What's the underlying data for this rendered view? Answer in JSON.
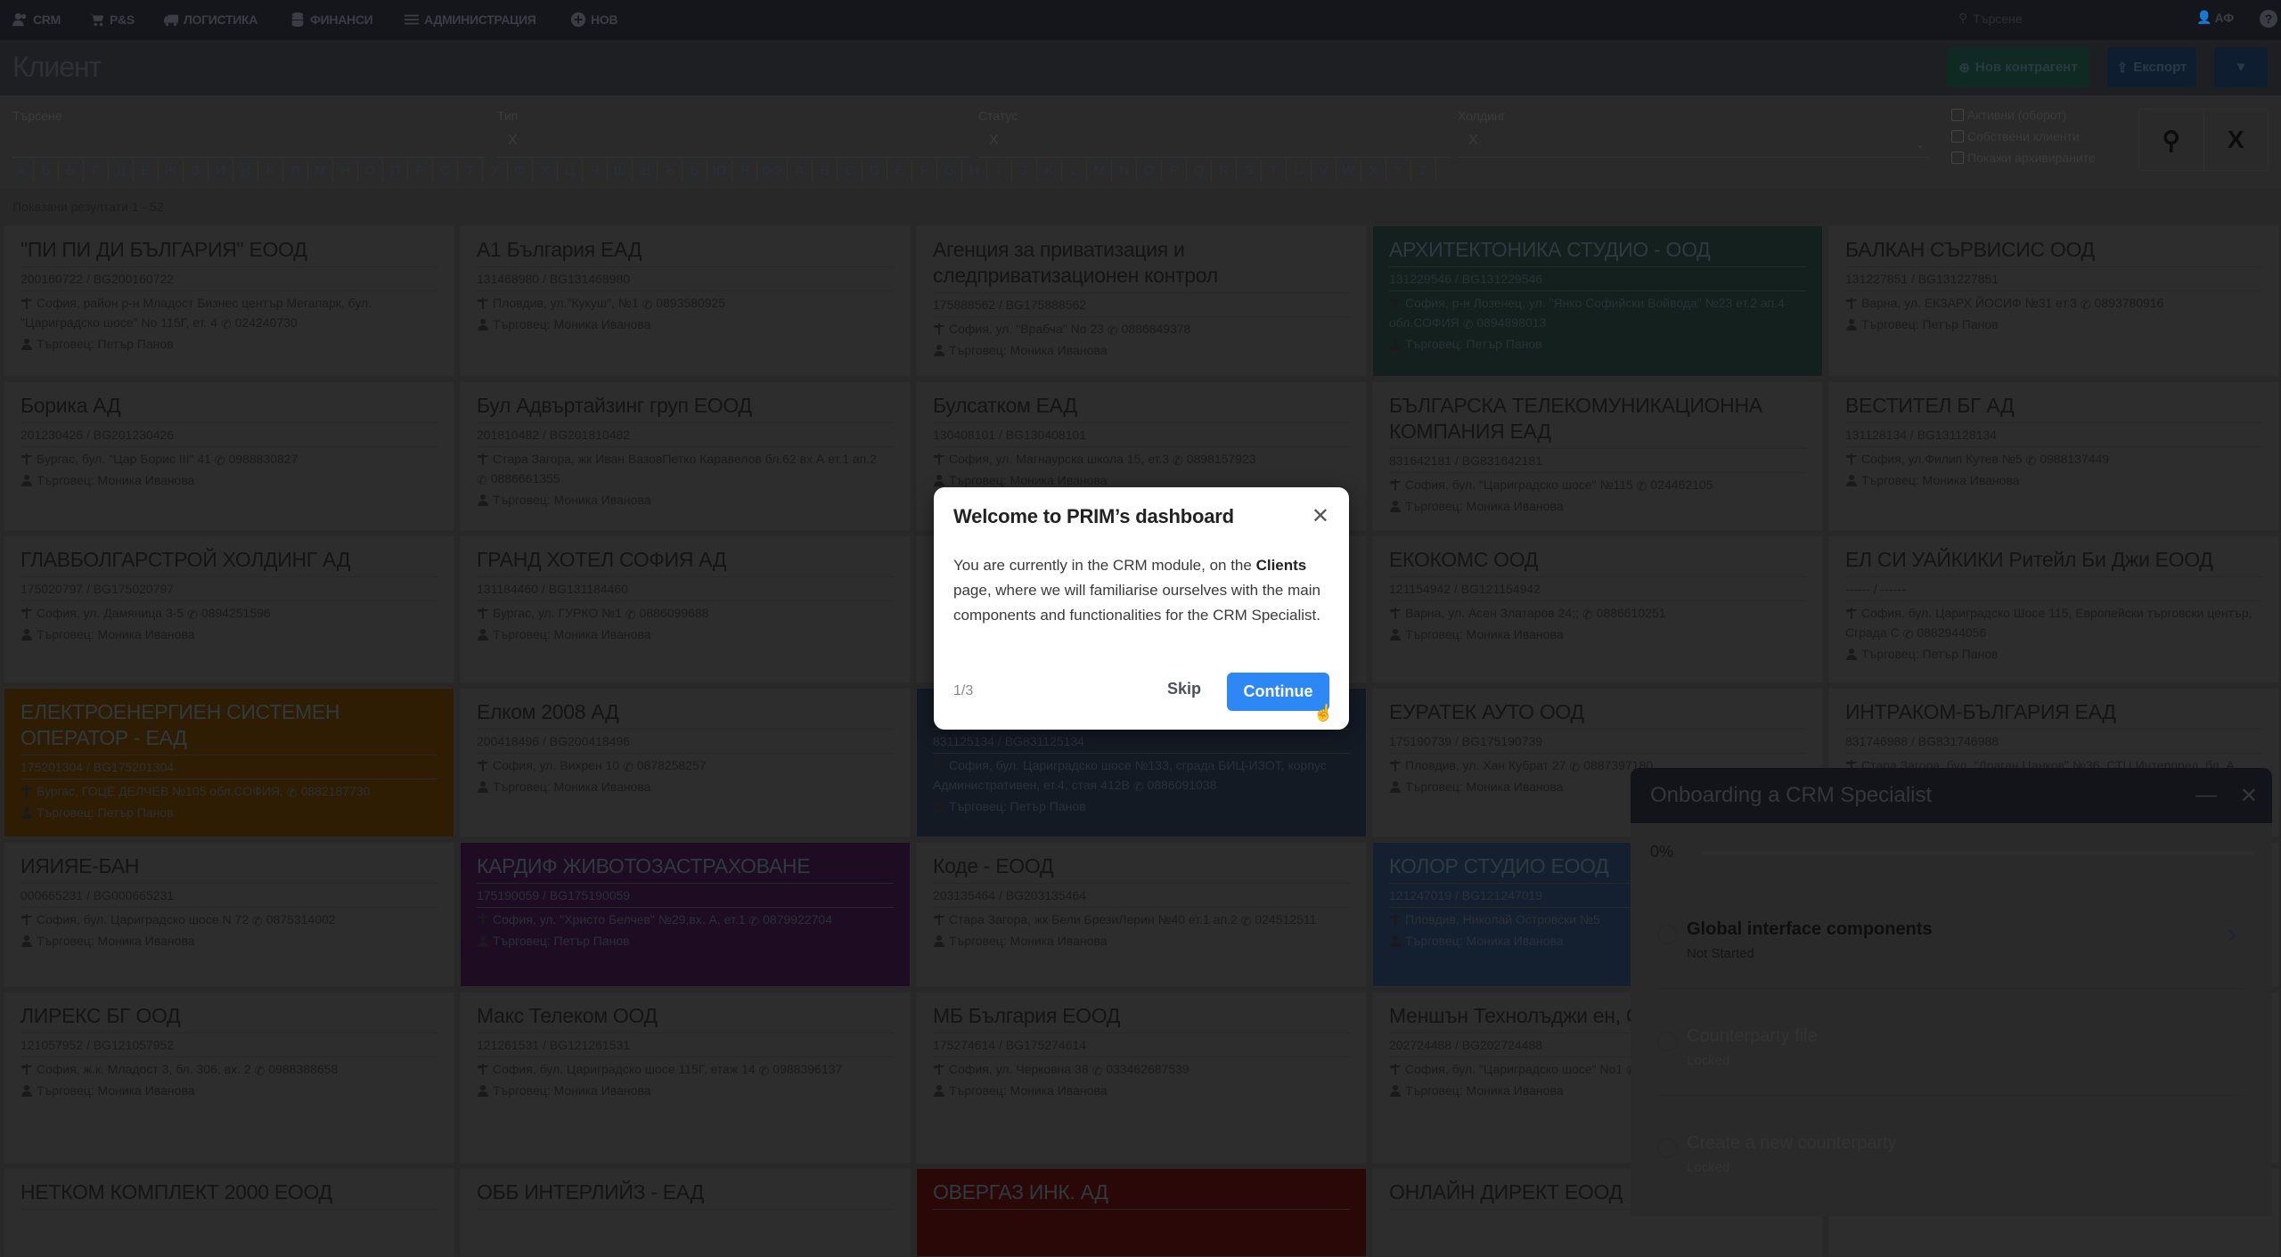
{
  "nav": {
    "items": [
      {
        "label": "CRM",
        "icon": "users-icon"
      },
      {
        "label": "P&S",
        "icon": "cart-icon"
      },
      {
        "label": "ЛОГИСТИКА",
        "icon": "truck-icon"
      },
      {
        "label": "ФИНАНСИ",
        "icon": "database-icon"
      },
      {
        "label": "АДМИНИСТРАЦИЯ",
        "icon": "sliders-icon"
      },
      {
        "label": "НОВ",
        "icon": "plus-circle-icon"
      }
    ],
    "search_placeholder": "Търсене",
    "user_initials": "АФ",
    "help": "?"
  },
  "header": {
    "title": "Клиент",
    "new_button": "Нов контрагент",
    "export_button": "Експорт",
    "colors": {
      "new": "#0f2a22",
      "export": "#0f1d30",
      "filter": "#0f1d30"
    }
  },
  "filters": {
    "search_label": "Търсене",
    "type_label": "Тип",
    "type_value": "X",
    "status_label": "Статус",
    "status_value": "X",
    "holding_label": "Холдинг",
    "holding_value": "X",
    "checkboxes": [
      "Активни (оборот)",
      "Собствени клиенти",
      "Покажи архивираните"
    ],
    "letters": [
      "А",
      "Б",
      "В",
      "Г",
      "Д",
      "Е",
      "Ж",
      "З",
      "И",
      "Й",
      "К",
      "Л",
      "М",
      "Н",
      "О",
      "П",
      "Р",
      "С",
      "Т",
      "У",
      "Ф",
      "Х",
      "Ц",
      "Ч",
      "Ш",
      "Щ",
      "Ъ",
      "Ь",
      "Ю",
      "Я",
      "0-9",
      "A",
      "B",
      "C",
      "D",
      "E",
      "F",
      "G",
      "H",
      "I",
      "J",
      "K",
      "L",
      "M",
      "N",
      "O",
      "P",
      "Q",
      "R",
      "S",
      "T",
      "U",
      "V",
      "W",
      "X",
      "Y",
      "Z"
    ],
    "clear": "X"
  },
  "results_text": "Показани резултати 1 - 52",
  "cards": [
    {
      "title": "\"ПИ ПИ ДИ БЪЛГАРИЯ\" ЕООД",
      "vat": "200160722 / BG200160722",
      "address": "София, район р-н Младост Бизнес център Мегапарк, бул. \"Цариградско шосе\" No 115Г, ет. 4",
      "phone": "024240730",
      "trader": "Търговец: Петър Панов"
    },
    {
      "title": "А1 България ЕАД",
      "vat": "131468980 / BG131468980",
      "address": "Пловдив, ул.\"Кукуш\", №1",
      "phone": "0893580925",
      "trader": "Търговец: Моника Иванова"
    },
    {
      "title": "Агенция за приватизация и следприватизационен контрол",
      "vat": "175888562 / BG175888562",
      "address": "София, ул. \"Врабча\" No 23",
      "phone": "0886849378",
      "trader": "Търговец: Моника Иванова"
    },
    {
      "title": "АРХИТЕКТОНИКА СТУДИО - ООД",
      "vat": "131229546 / BG131229546",
      "address": "София, р-н Лозенец, ул. \"Янко Софийски Войвода\" №23 ет.2 ап.4 обл.СОФИЯ",
      "phone": "0894898013",
      "trader": "Търговец: Петър Панов",
      "color": "#13201d"
    },
    {
      "title": "БАЛКАН СЪРВИСИС ООД",
      "vat": "131227851 / BG131227851",
      "address": "Варна, ул. ЕКЗАРХ ЙОСИФ №31 ет.3",
      "phone": "0893780916",
      "trader": "Търговец: Петър Панов"
    },
    {
      "title": "Борика АД",
      "vat": "201230426 / BG201230426",
      "address": "Бургас, бул. \"Цар Борис III\" 41",
      "phone": "0988830827",
      "trader": "Търговец: Моника Иванова"
    },
    {
      "title": "Бул Адвъртайзинг груп ЕООД",
      "vat": "201810482 / BG201810482",
      "address": "Стара Загора, жк Иван ВазовПетко Каравелов бл.62 вх.А ет.1 ап.2",
      "phone": "0886661355",
      "trader": "Търговец: Моника Иванова"
    },
    {
      "title": "Булсатком ЕАД",
      "vat": "130408101 / BG130408101",
      "address": "София, ул. Магнаурска школа 15, ет.3",
      "phone": "0898157923",
      "trader": "Търговец: Моника Иванова"
    },
    {
      "title": "БЪЛГАРСКА ТЕЛЕКОМУНИКАЦИОННА КОМПАНИЯ ЕАД",
      "vat": "831642181 / BG831642181",
      "address": "София, бул. \"Цариградско шосе\" №115",
      "phone": "024462105",
      "trader": "Търговец: Моника Иванова"
    },
    {
      "title": "ВЕСТИТЕЛ БГ АД",
      "vat": "131128134 / BG131128134",
      "address": "София, ул.Филип Кутев №5",
      "phone": "0988137449",
      "trader": "Търговец: Моника Иванова"
    },
    {
      "title": "ГЛАВБОЛГАРСТРОЙ ХОЛДИНГ АД",
      "vat": "175020797 / BG175020797",
      "address": "София, ул. Дамяница 3-5",
      "phone": "0894251596",
      "trader": "Търговец: Моника Иванова"
    },
    {
      "title": "ГРАНД ХОТЕЛ СОФИЯ АД",
      "vat": "131184460 / BG131184460",
      "address": "Бургас, ул. ГУРКО №1",
      "phone": "0886099688",
      "trader": "Търговец: Моника Иванова"
    },
    {
      "title": "",
      "vat": "",
      "address": "",
      "phone": "",
      "trader": ""
    },
    {
      "title": "ЕКОКОМС ООД",
      "vat": "121154942 / BG121154942",
      "address": "Варна, ул. Асен Златаров 24;;",
      "phone": "0886610251",
      "trader": "Търговец: Моника Иванова"
    },
    {
      "title": "ЕЛ СИ УАЙКИКИ Ритейл Би Джи ЕООД",
      "vat": "------ / ------",
      "address": "София, бул. Цариградско Шосе 115, Европейски търговски център, Сграда С",
      "phone": "0882944056",
      "trader": "Търговец: Петър Панов"
    },
    {
      "title": "ЕЛЕКТРОЕНЕРГИЕН СИСТЕМЕН ОПЕРАТОР - ЕАД",
      "vat": "175201304 / BG175201304",
      "address": "Бургас, ГОЦЕ ДЕЛЧЕВ №105 обл.СОФИЯ,",
      "phone": "0882187730",
      "trader": "Търговец: Петър Панов",
      "color": "#2e1d02"
    },
    {
      "title": "Елком 2008 АД",
      "vat": "200418496 / BG200418496",
      "address": "София, ул. Вихрен 10",
      "phone": "0878258257",
      "trader": "Търговец: Моника Иванова"
    },
    {
      "title": "",
      "vat": "831125134 / BG831125134",
      "address": "София, бул. Цариградско шосе №133, сграда БИЦ-ИЗОТ, корпус Административен, ет.4, стая 412В",
      "phone": "0886091038",
      "trader": "Търговец: Петър Панов",
      "color": "#131a24"
    },
    {
      "title": "ЕУРАТЕК АУТО ООД",
      "vat": "175190739 / BG175190739",
      "address": "Пловдив, ул. Хан Кубрат 27",
      "phone": "0887397180",
      "trader": "Търговец: Моника Иванова"
    },
    {
      "title": "ИНТРАКОМ-БЪЛГАРИЯ ЕАД",
      "vat": "831746988 / BG831746988",
      "address": "Стара Загора, бул. \"Драган Цанков\" №36, СТЦ Интерпред, бл. А",
      "phone": "",
      "trader": ""
    },
    {
      "title": "ИЯИЯЕ-БАН",
      "vat": "000665231 / BG000665231",
      "address": "София, бул. Цариградско шосе N 72",
      "phone": "0875314002",
      "trader": "Търговец: Моника Иванова"
    },
    {
      "title": "КАРДИФ ЖИВОТОЗАСТРАХОВАНЕ",
      "vat": "175190059 / BG175190059",
      "address": "София, ул. \"Христо Белчев\" №29,вх. А, ет.1",
      "phone": "0879922704",
      "trader": "Търговец: Петър Панов",
      "color": "#1e0c22"
    },
    {
      "title": "Коде - ЕООД",
      "vat": "203135464 / BG203135464",
      "address": "Стара Загора, жк Бели БрезиЛерин №40 ет.1 ап.2",
      "phone": "024512511",
      "trader": "Търговец: Моника Иванова"
    },
    {
      "title": "КОЛОР СТУДИО ЕООД",
      "vat": "121247019 / BG121247019",
      "address": "Пловдив, Николай Островски №5",
      "phone": "",
      "trader": "Търговец: Моника Иванова",
      "color": "#142030"
    },
    {
      "title": "",
      "vat": "",
      "address": "",
      "phone": "",
      "trader": ""
    },
    {
      "title": "ЛИРЕКС БГ ООД",
      "vat": "121057952 / BG121057952",
      "address": "София, ж.к. Младост 3, бл. 306, вх. 2",
      "phone": "0988388658",
      "trader": "Търговец: Моника Иванова"
    },
    {
      "title": "Макс Телеком ООД",
      "vat": "121261531 / BG121261531",
      "address": "София, бул. Цариградско шосе 115Г, етаж 14",
      "phone": "0988396137",
      "trader": "Търговец: Моника Иванова"
    },
    {
      "title": "МБ България ЕООД",
      "vat": "175274614 / BG175274614",
      "address": "София, ул. Черковна 38",
      "phone": "033462687539",
      "trader": "Търговец: Моника Иванова"
    },
    {
      "title": "Меншън Технолъджи ен, Сентър ЕООД",
      "vat": "202724488 / BG202724488",
      "address": "София, бул. \"Цариградско шосе\" No1",
      "phone": "029890995",
      "trader": "Търговец: Моника Иванова"
    },
    {
      "title": "",
      "vat": "",
      "address": "",
      "phone": "",
      "trader": ""
    },
    {
      "title": "НЕТКОМ КОМПЛЕКТ 2000 ЕООД",
      "vat": "",
      "address": "",
      "phone": "",
      "trader": ""
    },
    {
      "title": "ОББ ИНТЕРЛИЙЗ - ЕАД",
      "vat": "",
      "address": "",
      "phone": "",
      "trader": ""
    },
    {
      "title": "ОВЕРГАЗ ИНК. АД",
      "vat": "",
      "address": "",
      "phone": "",
      "trader": "",
      "color": "#2a0808"
    },
    {
      "title": "ОНЛАЙН ДИРЕКТ ЕООД",
      "vat": "",
      "address": "",
      "phone": "",
      "trader": ""
    },
    {
      "title": "",
      "vat": "",
      "address": "",
      "phone": "",
      "trader": ""
    }
  ],
  "modal": {
    "title": "Welcome to PRIM’s dashboard",
    "body_pre": "You are currently in the CRM module, on the ",
    "body_bold": "Clients",
    "body_post": " page, where we will familiarise ourselves with the main components and functionalities for the CRM Specialist.",
    "step": "1/3",
    "skip": "Skip",
    "continue": "Continue",
    "accent": "#2d88f5"
  },
  "onboarding": {
    "title": "Onboarding a CRM Specialist",
    "progress_text": "0%",
    "progress": 0,
    "items": [
      {
        "name": "Global interface components",
        "status": "Not Started"
      },
      {
        "name": "Counterparty file",
        "status": "Locked"
      },
      {
        "name": "Create a new counterparty",
        "status": "Locked"
      }
    ]
  }
}
